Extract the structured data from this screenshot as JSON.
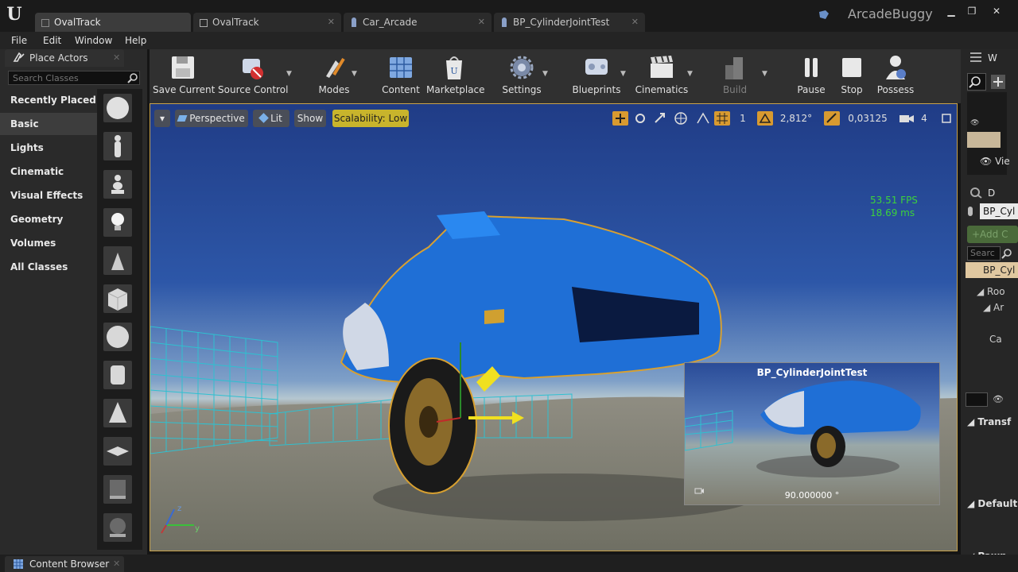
{
  "app": {
    "name": "ArcadeBuggy"
  },
  "tabs": [
    {
      "label": "OvalTrack",
      "active": true
    },
    {
      "label": "OvalTrack",
      "active": false
    },
    {
      "label": "Car_Arcade",
      "active": false
    },
    {
      "label": "BP_CylinderJointTest",
      "active": false
    }
  ],
  "window_controls": {
    "minimize": "▁",
    "maximize": "❐",
    "close": "✕"
  },
  "menu": [
    "File",
    "Edit",
    "Window",
    "Help"
  ],
  "place_actors": {
    "title": "Place Actors",
    "search_placeholder": "Search Classes",
    "categories": [
      "Recently Placed",
      "Basic",
      "Lights",
      "Cinematic",
      "Visual Effects",
      "Geometry",
      "Volumes",
      "All Classes"
    ],
    "active_category": "Basic",
    "items": [
      "sphere-thumb",
      "character-thumb",
      "pawn-thumb",
      "point-light-thumb",
      "player-start-thumb",
      "cube-thumb",
      "sphere-thumb",
      "cylinder-thumb",
      "cone-thumb",
      "plane-thumb",
      "box-trigger-thumb",
      "sphere-trigger-thumb"
    ]
  },
  "toolbar": [
    {
      "label": "Save Current",
      "icon": "save-icon"
    },
    {
      "label": "Source Control",
      "icon": "source-control-icon"
    },
    {
      "label": "Modes",
      "icon": "modes-icon"
    },
    {
      "label": "Content",
      "icon": "content-icon"
    },
    {
      "label": "Marketplace",
      "icon": "marketplace-icon"
    },
    {
      "label": "Settings",
      "icon": "settings-icon"
    },
    {
      "label": "Blueprints",
      "icon": "blueprints-icon"
    },
    {
      "label": "Cinematics",
      "icon": "cinematics-icon"
    },
    {
      "label": "Build",
      "icon": "build-icon"
    },
    {
      "label": "Pause",
      "icon": "pause-icon"
    },
    {
      "label": "Stop",
      "icon": "stop-icon"
    },
    {
      "label": "Possess",
      "icon": "possess-icon"
    }
  ],
  "viewport": {
    "perspective": "Perspective",
    "lit": "Lit",
    "show": "Show",
    "scalability": "Scalability: Low",
    "grid_snap": "1",
    "rotation_snap": "2,812°",
    "scale_snap": "0,03125",
    "camera_speed": "4",
    "fps": "53.51 FPS",
    "frame_ms": "18.69 ms",
    "preview_title": "BP_CylinderJointTest",
    "preview_angle": "90.000000 °"
  },
  "right_panel": {
    "world_tab": "W",
    "view_label": "Vie",
    "details_tab": "D",
    "bp_name": "BP_Cyl",
    "add_component": "+Add C",
    "search": "Searc",
    "bp_item": "BP_Cyl",
    "tree": [
      "Roo",
      "Ar",
      "Ca"
    ],
    "sections": [
      "Transf",
      "Default",
      "Pawn"
    ]
  },
  "bottom": {
    "content_browser": "Content Browser"
  },
  "colors": {
    "accent": "#c8a24a",
    "scalability": "#c8b42c",
    "fps": "#3cd23c",
    "car": "#1e6fd0"
  }
}
